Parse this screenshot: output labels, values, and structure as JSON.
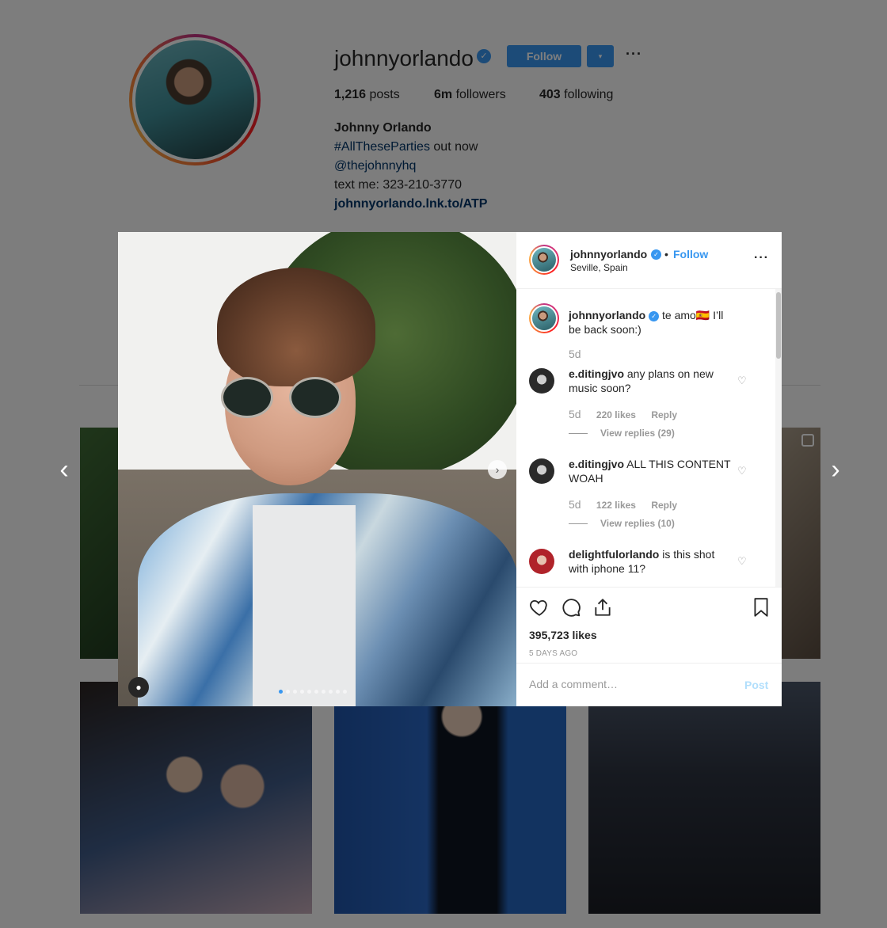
{
  "profile": {
    "username": "johnnyorlando",
    "follow_label": "Follow",
    "dropdown_icon": "▾",
    "more_icon": "···",
    "stats": {
      "posts_count": "1,216",
      "posts_label": "posts",
      "followers_count": "6m",
      "followers_label": "followers",
      "following_count": "403",
      "following_label": "following"
    },
    "bio": {
      "name": "Johnny Orlando",
      "hashtag": "#AllTheseParties",
      "line2_suffix": " out now",
      "mention": "@thejohnnyhq",
      "phone": "text me: 323-210-3770",
      "link": "johnnyorlando.lnk.to/ATP"
    }
  },
  "modal": {
    "header": {
      "username": "johnnyorlando",
      "bullet": "•",
      "follow_label": "Follow",
      "location": "Seville, Spain",
      "more_icon": "···"
    },
    "comments": [
      {
        "username": "johnnyorlando",
        "text": " te amo🇪🇸  I’ll be back soon:)",
        "age": "5d",
        "verified": true
      },
      {
        "username": "e.ditingjvo",
        "text": " any plans on new music soon?",
        "age": "5d",
        "likes": "220 likes",
        "reply": "Reply",
        "replies": "View replies (29)"
      },
      {
        "username": "e.ditingjvo",
        "text": " ALL THIS CONTENT WOAH",
        "age": "5d",
        "likes": "122 likes",
        "reply": "Reply",
        "replies": "View replies (10)"
      },
      {
        "username": "delightfulorlando",
        "text": " is this shot with iphone 11?"
      }
    ],
    "likes": "395,723 likes",
    "time_ago": "5 DAYS AGO",
    "add_comment_placeholder": "Add a comment…",
    "post_label": "Post"
  },
  "nav": {
    "prev_icon": "‹",
    "next_icon": "›",
    "media_next_icon": "›"
  },
  "colors": {
    "accent": "#3897f0",
    "link": "#003569",
    "muted": "#999999"
  }
}
